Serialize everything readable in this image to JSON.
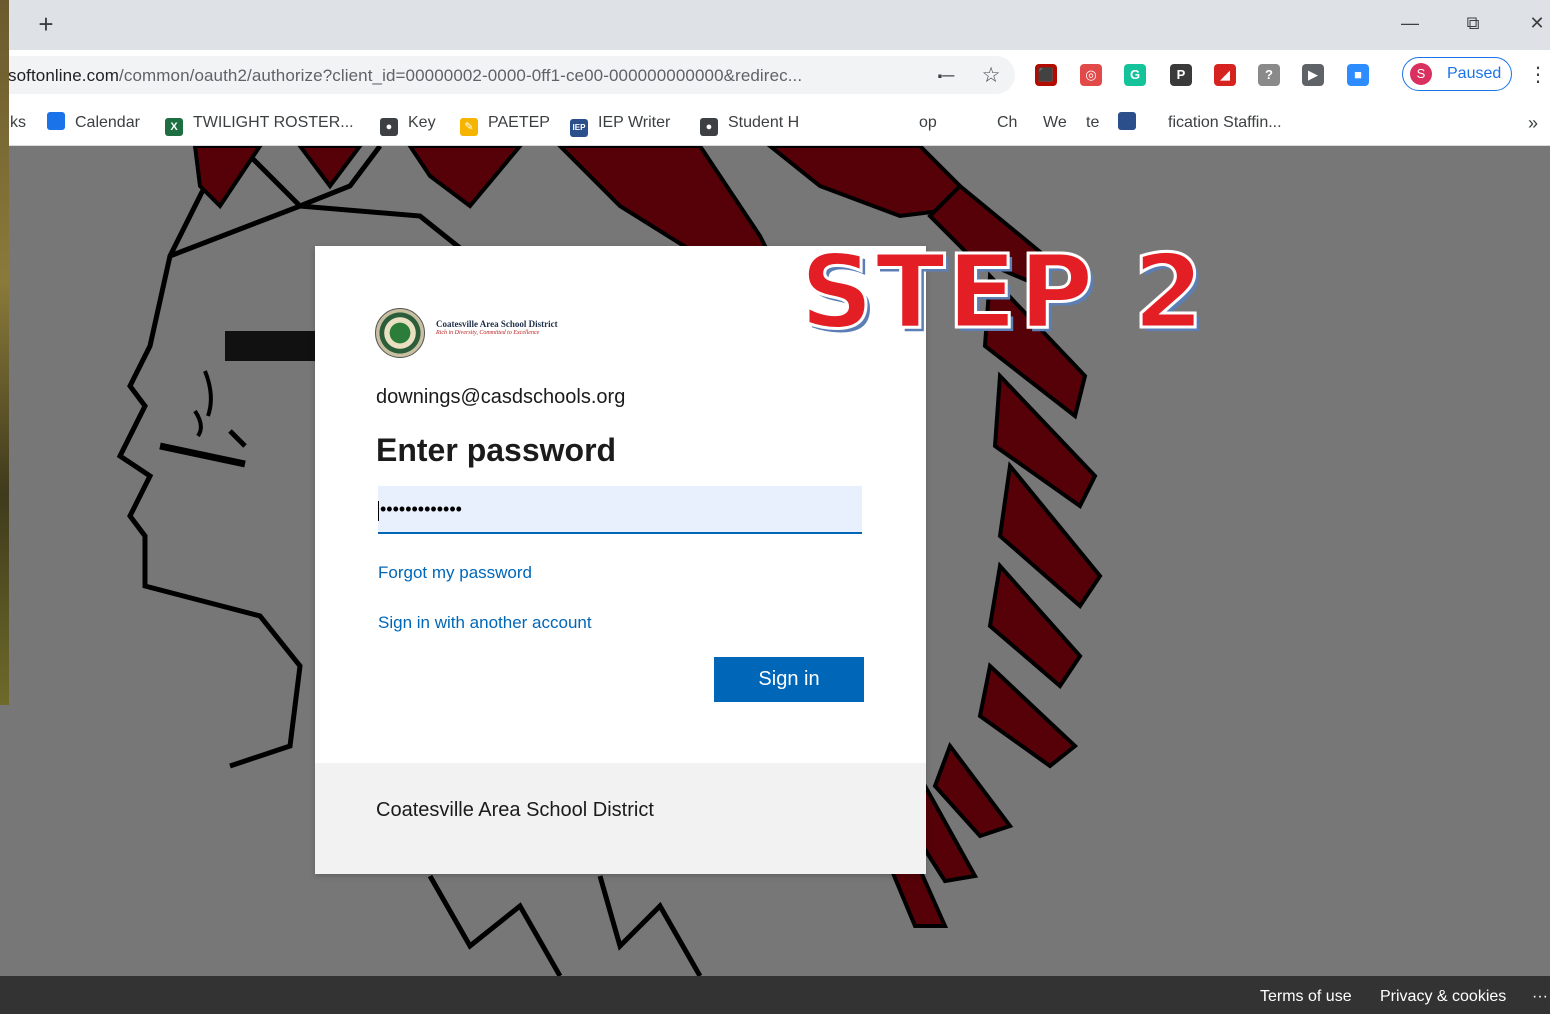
{
  "browser": {
    "new_tab": "+",
    "window_controls": {
      "minimize": "—",
      "restore": "⧉",
      "close": "✕"
    },
    "url_host": "softonline.com",
    "url_path": "/common/oauth2/authorize?client_id=00000002-0000-0ff1-ce00-000000000000&redirec...",
    "omnibox_icons": [
      "key-icon",
      "star-icon"
    ],
    "extensions": [
      {
        "name": "acrobat-extension-icon",
        "glyph": "⬛",
        "color": "#b30b00"
      },
      {
        "name": "spiral-extension-icon",
        "glyph": "◎",
        "color": "#e24a4a"
      },
      {
        "name": "grammarly-extension-icon",
        "glyph": "G",
        "color": "#15c39a"
      },
      {
        "name": "pearltrees-extension-icon",
        "glyph": "P",
        "color": "#3a3a3a"
      },
      {
        "name": "pen-extension-icon",
        "glyph": "◢",
        "color": "#d6231f"
      },
      {
        "name": "help-extension-icon",
        "glyph": "?",
        "color": "#8a8a8a"
      },
      {
        "name": "media-extension-icon",
        "glyph": "▶",
        "color": "#5f6368"
      },
      {
        "name": "zoom-extension-icon",
        "glyph": "■",
        "color": "#2d8cff"
      }
    ],
    "profile": {
      "initial": "S",
      "label": "Paused"
    },
    "menu": "⋮"
  },
  "bookmarks": {
    "partial": "ks",
    "items": [
      {
        "label": "Calendar",
        "icon": "calendar-icon",
        "glyph": "",
        "color": "#1a73e8"
      },
      {
        "label": "TWILIGHT ROSTER...",
        "icon": "excel-icon",
        "glyph": "X",
        "color": "#1d6f42"
      },
      {
        "label": "Key",
        "icon": "globe-icon",
        "glyph": "●",
        "color": "#3c4043"
      },
      {
        "label": "PAETEP",
        "icon": "pencil-icon",
        "glyph": "✎",
        "color": "#f4b400"
      },
      {
        "label": "IEP Writer",
        "icon": "iep-icon",
        "glyph": "IEP",
        "color": "#2b4f8a"
      },
      {
        "label": "Student H",
        "icon": "globe-icon",
        "glyph": "●",
        "color": "#3c4043"
      }
    ],
    "obscured": [
      "op",
      "Ch",
      "We",
      "te"
    ],
    "last": "fication Staffin...",
    "overflow": "»"
  },
  "overlay": {
    "step_label": "STEP 2"
  },
  "signin_card": {
    "logo_name": "Coatesville Area School District",
    "logo_tagline": "Rich in Diversity, Committed to Excellence",
    "email": "downings@casdschools.org",
    "heading": "Enter password",
    "password_value": "•••••••••••••",
    "forgot_link": "Forgot my password",
    "other_account_link": "Sign in with another account",
    "signin_button": "Sign in",
    "footer_text": "Coatesville Area School District"
  },
  "page_footer": {
    "terms": "Terms of use",
    "privacy": "Privacy & cookies",
    "more": "···"
  }
}
